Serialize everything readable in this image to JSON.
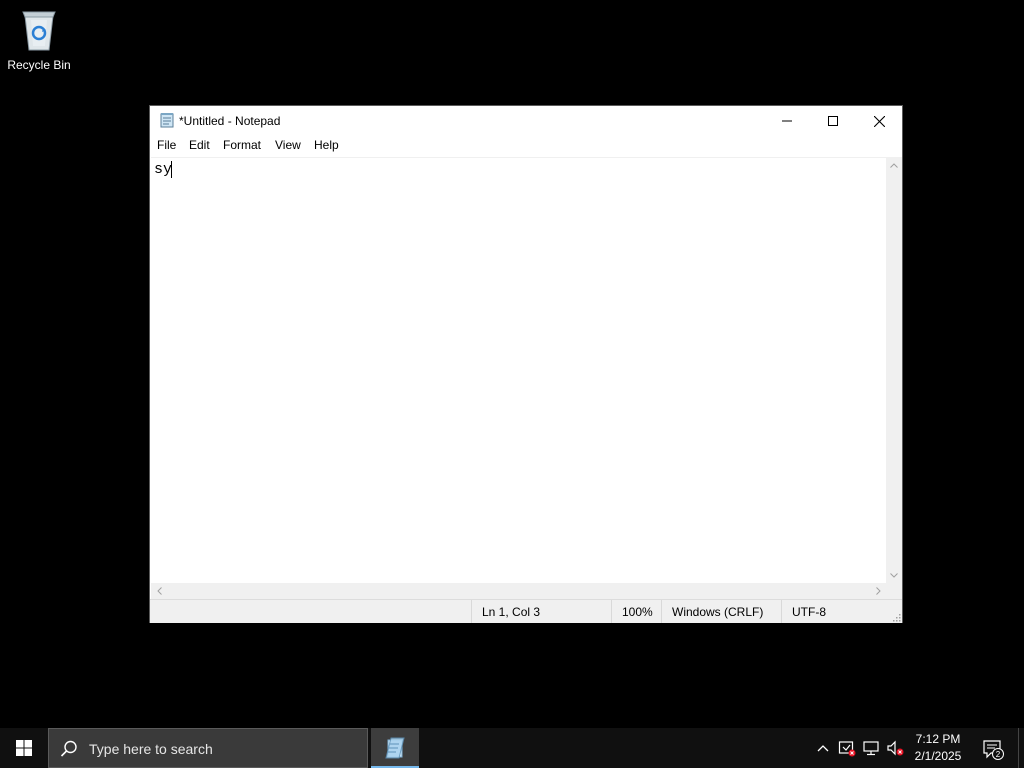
{
  "desktop": {
    "icons": [
      {
        "label": "Recycle Bin",
        "icon": "recycle-bin-icon"
      }
    ]
  },
  "window": {
    "title": "*Untitled - Notepad",
    "menu": [
      "File",
      "Edit",
      "Format",
      "View",
      "Help"
    ],
    "content": "sy",
    "status": {
      "position": "Ln 1, Col 3",
      "zoom": "100%",
      "line_ending": "Windows (CRLF)",
      "encoding": "UTF-8"
    }
  },
  "taskbar": {
    "search_placeholder": "Type here to search",
    "pinned_apps": [
      {
        "name": "notepad-icon",
        "active": true
      }
    ],
    "tray_icons": [
      "chevron-up-icon",
      "security-icon",
      "network-icon",
      "volume-muted-icon"
    ],
    "clock": {
      "time": "7:12 PM",
      "date": "2/1/2025"
    },
    "notifications_count": "2"
  },
  "colors": {
    "taskbar_bg": "#101010",
    "search_bg": "#3a3a3a",
    "active_underline": "#76b9ed",
    "status_bg": "#f0f0f0"
  }
}
